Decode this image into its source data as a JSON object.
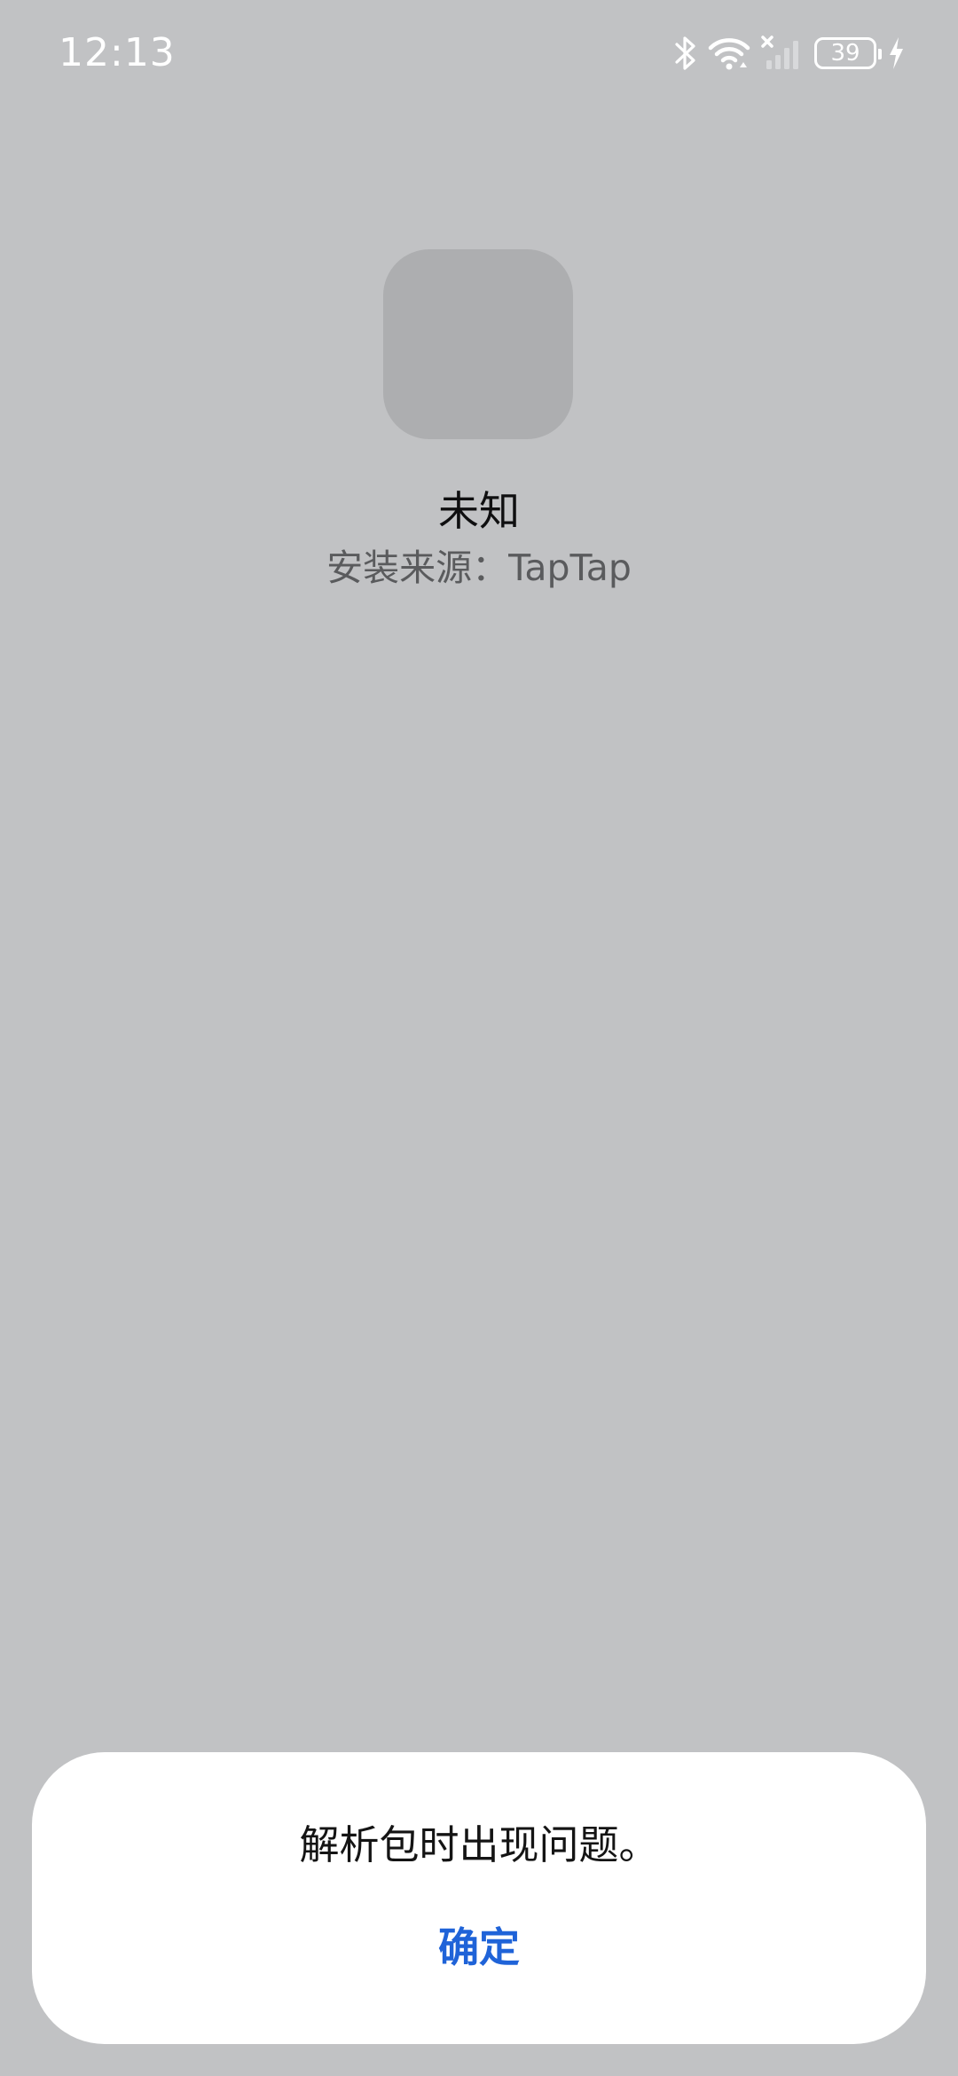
{
  "status_bar": {
    "time": "12:13",
    "battery_level": "39",
    "icons": [
      "bluetooth-icon",
      "wifi-icon",
      "no-signal-icon",
      "battery-icon",
      "charging-icon"
    ]
  },
  "app": {
    "name": "未知",
    "install_source": "安装来源：TapTap"
  },
  "dialog": {
    "message": "解析包时出现问题。",
    "confirm_label": "确定"
  },
  "colors": {
    "background": "#c1c2c4",
    "icon_placeholder": "#adaeb0",
    "dialog_background": "#ffffff",
    "accent": "#1f63d8"
  }
}
